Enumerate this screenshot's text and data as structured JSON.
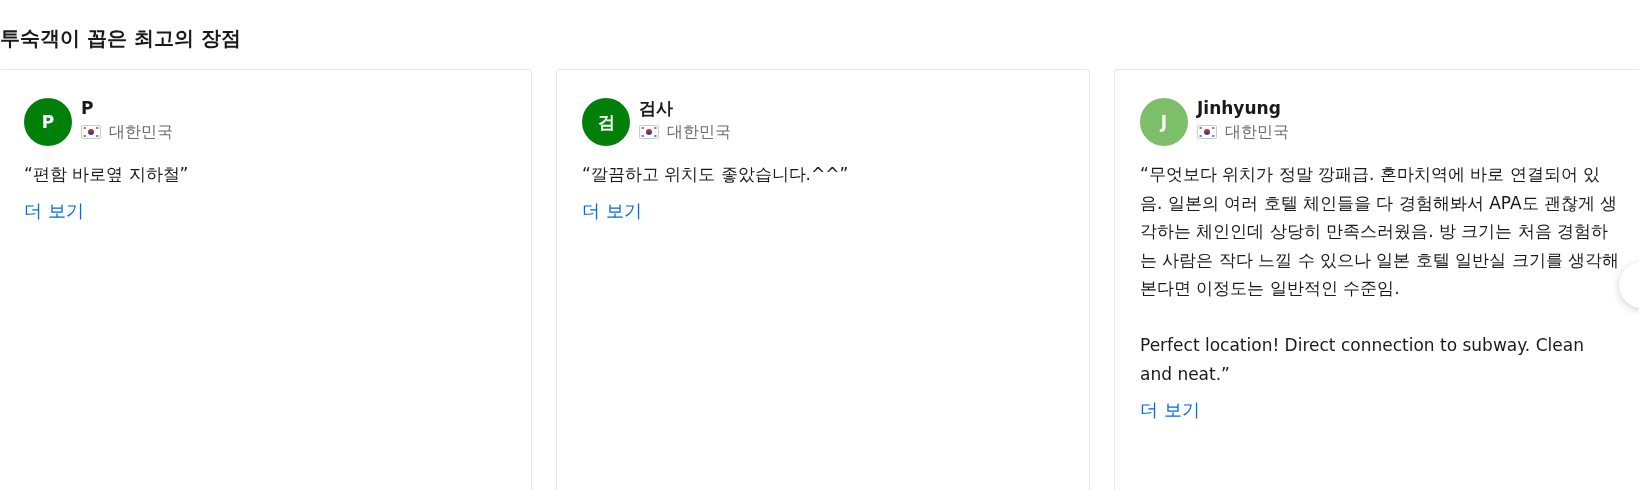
{
  "section_title": "투숙객이 꼽은 최고의 장점",
  "reviews": [
    {
      "avatar_letter": "P",
      "color": "#008009",
      "name": "P",
      "country": "대한민국",
      "text": "“편함 바로옆 지하철”",
      "more_link": "더 보기"
    },
    {
      "avatar_letter": "검",
      "color": "#008009",
      "name": "검사",
      "country": "대한민국",
      "text": "“깔끔하고 위치도 좋았습니다.^^”",
      "more_link": "더 보기"
    },
    {
      "avatar_letter": "J",
      "color": "#7dbf68",
      "name": "Jinhyung",
      "country": "대한민국",
      "text": "“무엇보다 위치가 정말 깡패급. 혼마치역에 바로 연결되어 있음. 일본의 여러 호텔 체인들을 다 경험해봐서 APA도 괜찮게 생각하는 체인인데 상당히 만족스러웠음. 방 크기는 처음 경험하는 사람은 작다 느낄 수 있으나 일본 호텔 일반실 크기를 생각해 본다면 이정도는 일반적인 수준임.\n\nPerfect location! Direct connection to subway. Clean and neat.”",
      "more_link": "더 보기"
    }
  ]
}
